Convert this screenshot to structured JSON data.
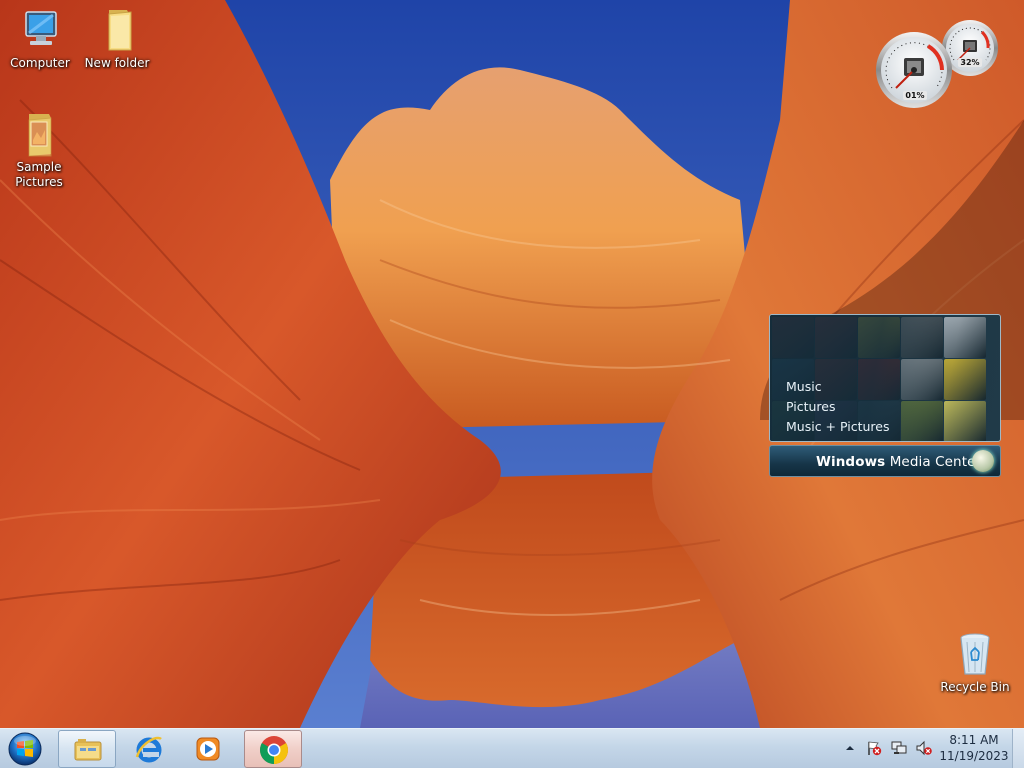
{
  "desktop": {
    "icons": [
      {
        "name": "computer",
        "label": "Computer"
      },
      {
        "name": "new-folder",
        "label": "New folder"
      },
      {
        "name": "sample-pictures",
        "label": "Sample Pictures"
      },
      {
        "name": "recycle-bin",
        "label": "Recycle Bin"
      }
    ]
  },
  "gadgets": {
    "cpu_meter": {
      "cpu_percent": "01%",
      "memory_percent": "32%",
      "cpu_value": 0.01,
      "memory_value": 0.32
    },
    "media_center": {
      "menu": [
        "Music",
        "Pictures",
        "Music + Pictures"
      ],
      "title_bold": "Windows",
      "title_rest": "Media Center",
      "tile_colors": [
        "#b04f4f",
        "#a84444",
        "#d6c84a",
        "#8a8a8a",
        "#cfd6dc",
        "#4a86b4",
        "#9d3a3a",
        "#a83030",
        "#d2d2d2",
        "#e6c838",
        "#4f8f6f",
        "#5a5a8a",
        "#3c5c70",
        "#8aa044",
        "#d8d060"
      ]
    }
  },
  "taskbar": {
    "items": [
      {
        "name": "windows-explorer",
        "state": "pinned"
      },
      {
        "name": "internet-explorer",
        "state": "pinned"
      },
      {
        "name": "windows-media-player",
        "state": "pinned"
      },
      {
        "name": "google-chrome",
        "state": "running"
      }
    ],
    "tray": {
      "icons": [
        "show-hidden-icons",
        "action-center-alert",
        "network",
        "volume-muted"
      ],
      "time": "8:11 AM",
      "date": "11/19/2023"
    }
  },
  "colors": {
    "taskbar": "#c4d6e8",
    "sky": "#2f56b8",
    "rock": "#d2601e"
  }
}
